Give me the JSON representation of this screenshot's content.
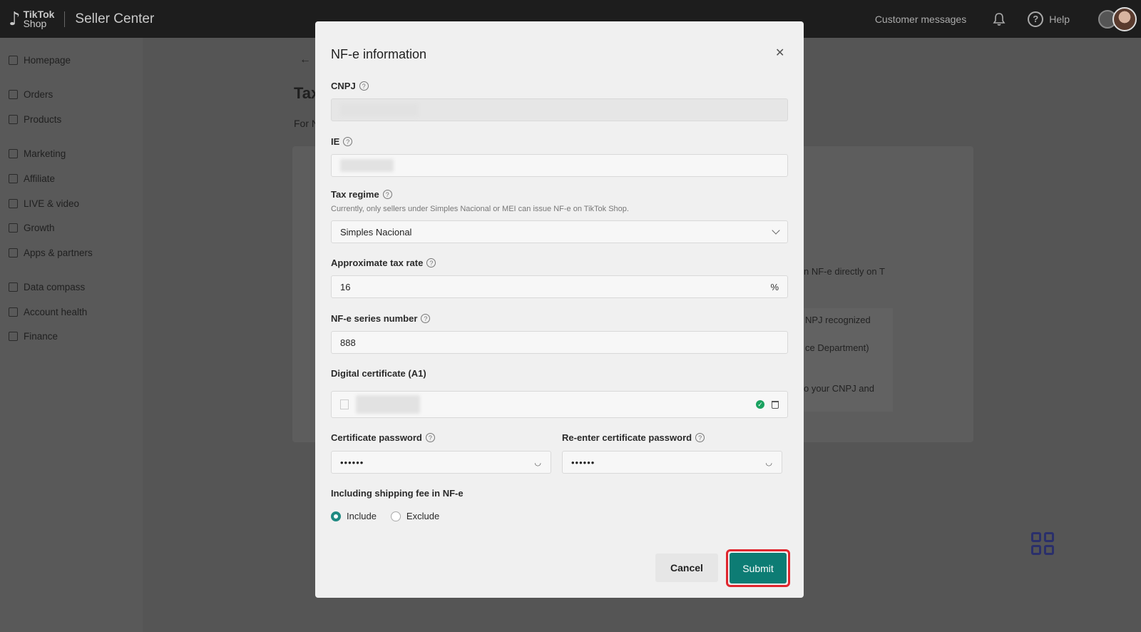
{
  "header": {
    "brand_line1": "TikTok",
    "brand_line2": "Shop",
    "title": "Seller Center",
    "customer_messages": "Customer messages",
    "help": "Help"
  },
  "sidebar": {
    "items": [
      {
        "label": "Homepage",
        "icon": "home-icon"
      },
      {
        "label": "Orders",
        "icon": "clipboard-icon"
      },
      {
        "label": "Products",
        "icon": "box-icon"
      },
      {
        "label": "Marketing",
        "icon": "megaphone-icon"
      },
      {
        "label": "Affiliate",
        "icon": "users-icon"
      },
      {
        "label": "LIVE & video",
        "icon": "video-icon"
      },
      {
        "label": "Growth",
        "icon": "medal-icon"
      },
      {
        "label": "Apps & partners",
        "icon": "apps-icon"
      },
      {
        "label": "Data compass",
        "icon": "chart-icon"
      },
      {
        "label": "Account health",
        "icon": "trophy-icon"
      },
      {
        "label": "Finance",
        "icon": "wallet-icon"
      }
    ]
  },
  "background": {
    "title_fragment": "Tax",
    "subtitle_fragment": "For N",
    "notes": [
      "n NF-e directly on T",
      "NPJ recognized",
      "ce Department)",
      "o your CNPJ and"
    ]
  },
  "modal": {
    "title": "NF-e information",
    "cnpj_label": "CNPJ",
    "ie_label": "IE",
    "tax_regime_label": "Tax regime",
    "tax_regime_hint": "Currently, only sellers under Simples Nacional or MEI can issue NF-e on TikTok Shop.",
    "tax_regime_value": "Simples Nacional",
    "tax_rate_label": "Approximate tax rate",
    "tax_rate_value": "16",
    "tax_rate_unit": "%",
    "series_label": "NF-e series number",
    "series_value": "888",
    "certificate_label": "Digital certificate (A1)",
    "cert_password_label": "Certificate password",
    "cert_password_value": "••••••",
    "cert_password_reenter_label": "Re-enter certificate password",
    "cert_password_reenter_value": "••••••",
    "shipping_label": "Including shipping fee in NF-e",
    "shipping_options": [
      "Include",
      "Exclude"
    ],
    "shipping_selected": "Include",
    "cancel": "Cancel",
    "submit": "Submit"
  },
  "colors": {
    "accent": "#0d7c74",
    "highlight": "#e0262e",
    "success": "#1aa260"
  }
}
